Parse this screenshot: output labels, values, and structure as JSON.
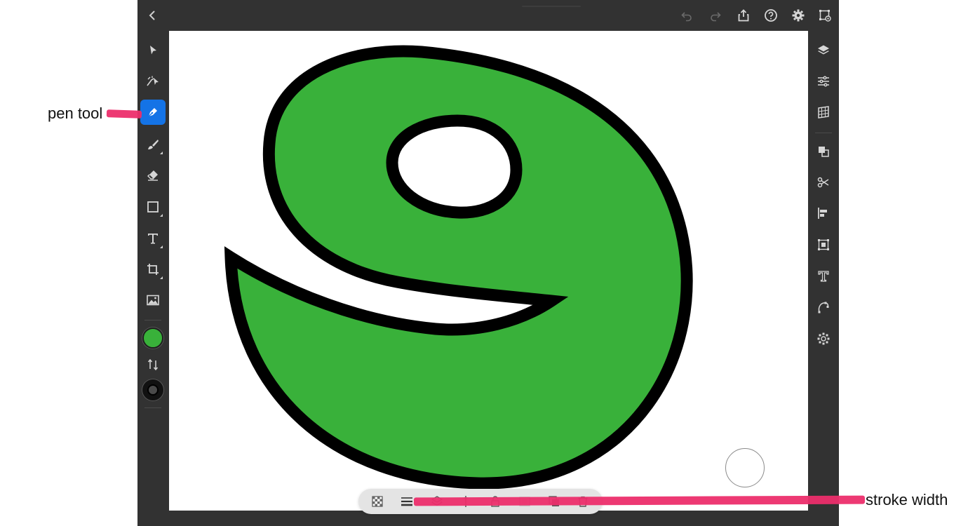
{
  "annotations": {
    "pen_tool": "pen tool",
    "stroke_width": "stroke width"
  },
  "colors": {
    "app_bg": "#323232",
    "canvas_bg": "#ffffff",
    "shape_fill": "#39b13a",
    "shape_stroke": "#000000",
    "accent_active": "#1473e6",
    "annotation_marker": "#ec2e6b"
  },
  "topbar": {
    "icons": [
      "back-icon",
      "undo-icon",
      "redo-icon",
      "share-icon",
      "help-icon",
      "settings-icon",
      "artboard-preview-icon"
    ]
  },
  "left_toolbar": {
    "tools": [
      "selection-tool",
      "direct-selection-tool",
      "pen-tool",
      "brush-tool",
      "eraser-tool",
      "shape-tool",
      "type-tool",
      "crop-tool",
      "place-image-tool"
    ],
    "active_tool": "pen-tool",
    "fill_color": "#39b13a",
    "stroke_color": "#000000"
  },
  "right_toolbar": {
    "icons": [
      "layers-icon",
      "properties-icon",
      "grid-icon",
      "combine-shapes-icon",
      "cut-icon",
      "align-icon",
      "transform-icon",
      "type-properties-icon",
      "path-icon",
      "repeat-icon"
    ]
  },
  "bottom_bar": {
    "icons": [
      "transparency-icon",
      "stroke-width-icon",
      "arrange-icon",
      "align-vertical-icon",
      "lock-icon",
      "mask-icon",
      "duplicate-icon",
      "delete-icon"
    ]
  }
}
